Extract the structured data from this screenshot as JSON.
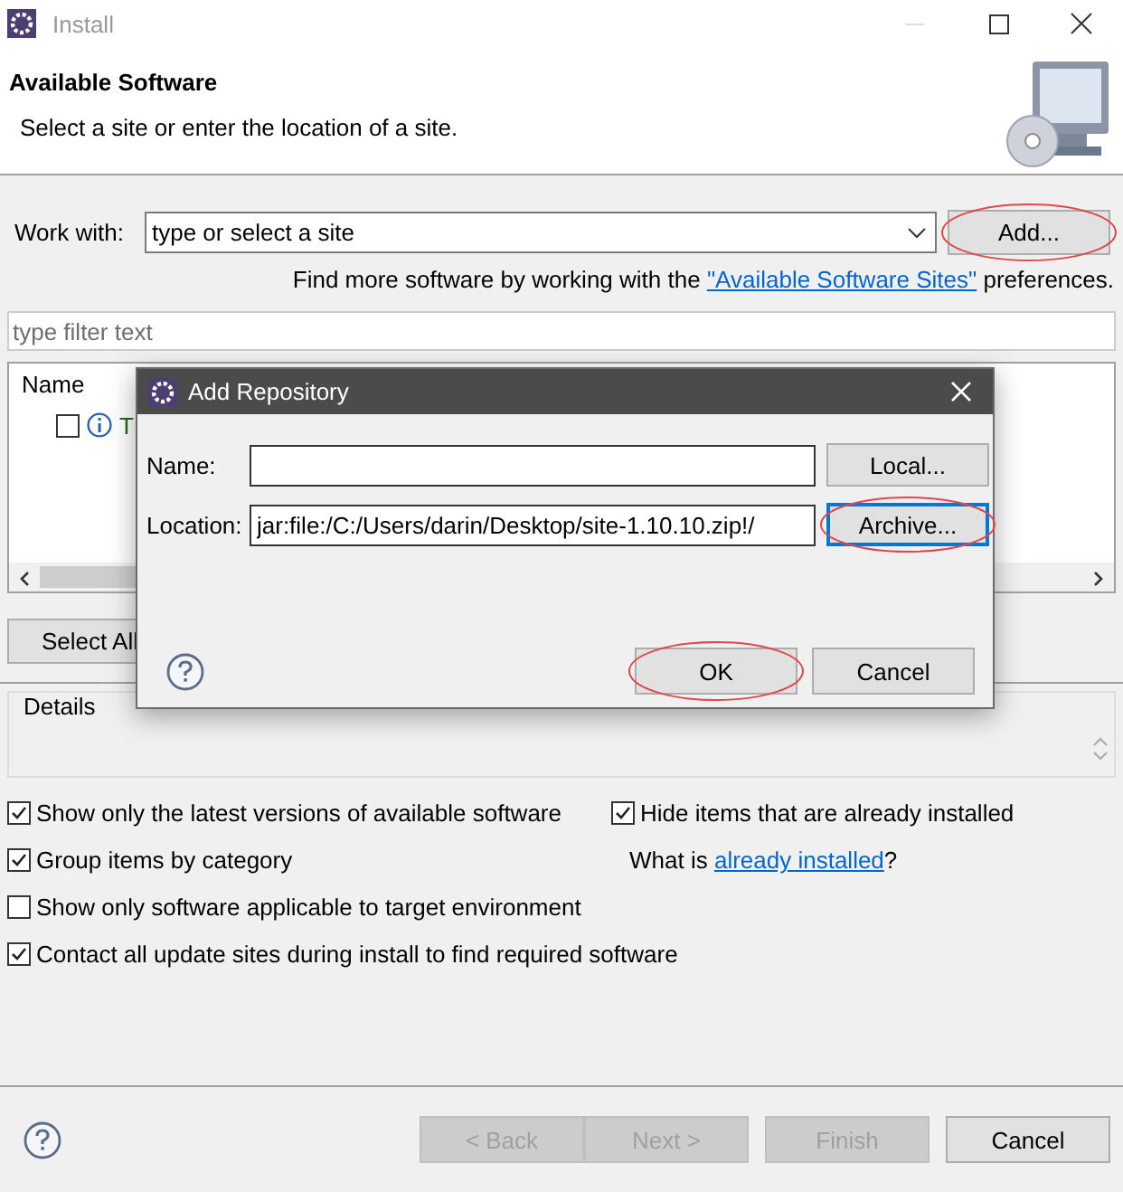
{
  "window": {
    "title": "Install"
  },
  "header": {
    "title": "Available Software",
    "subtitle": "Select a site or enter the location of a site."
  },
  "work_with": {
    "label": "Work with:",
    "placeholder": "type or select a site"
  },
  "add_button": {
    "label": "Add...",
    "circled": true
  },
  "more_software": {
    "before": "Find more software by working with the ",
    "link": "\"Available Software Sites\"",
    "after": " preferences."
  },
  "filter": {
    "placeholder": "type filter text"
  },
  "table": {
    "columns": [
      "Name"
    ],
    "rows": [
      {
        "checked": false,
        "label": "T"
      }
    ]
  },
  "select_all_button": "Select All",
  "details": {
    "title": "Details"
  },
  "options_left": [
    {
      "label": "Show only the latest versions of available software",
      "checked": true
    },
    {
      "label": "Group items by category",
      "checked": true
    },
    {
      "label": "Show only software applicable to target environment",
      "checked": false
    },
    {
      "label": "Contact all update sites during install to find required software",
      "checked": true
    }
  ],
  "options_right": [
    {
      "kind": "checkbox",
      "label": "Hide items that are already installed",
      "checked": true
    },
    {
      "kind": "link_text",
      "before": "What is ",
      "link": "already installed",
      "after": "?"
    }
  ],
  "buttons": [
    {
      "label": "< Back",
      "disabled": true
    },
    {
      "label": "Next >",
      "disabled": true
    },
    {
      "label": "Finish",
      "disabled": true
    },
    {
      "label": "Cancel",
      "disabled": false
    }
  ],
  "dialog": {
    "title": "Add Repository",
    "fields": [
      {
        "label": "Name:",
        "button": {
          "label": "Local...",
          "focused": false,
          "circled": false
        }
      },
      {
        "label": "Location:",
        "value": "jar:file:/C:/Users/darin/Desktop/site-1.10.10.zip!/",
        "button": {
          "label": "Archive...",
          "focused": true,
          "circled": true
        }
      }
    ],
    "buttons": [
      {
        "label": "OK",
        "circled": true
      },
      {
        "label": "Cancel",
        "circled": false
      }
    ]
  }
}
